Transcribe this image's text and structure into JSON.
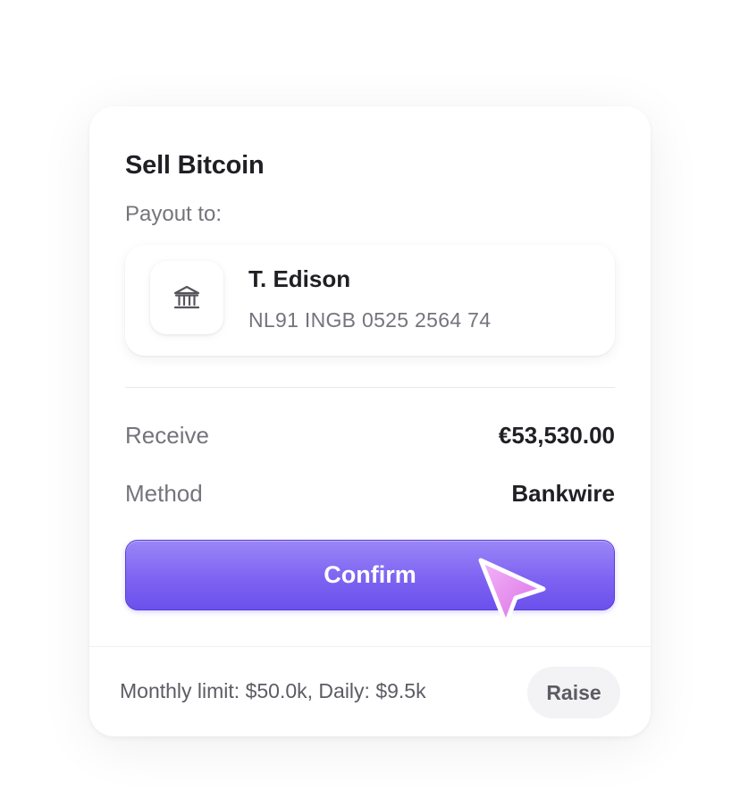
{
  "card": {
    "title": "Sell Bitcoin",
    "payout_label": "Payout to:"
  },
  "payee": {
    "icon": "bank-icon",
    "name": "T. Edison",
    "iban": "NL91 INGB 0525 2564 74"
  },
  "summary": {
    "receive_label": "Receive",
    "receive_value": "€53,530.00",
    "method_label": "Method",
    "method_value": "Bankwire"
  },
  "actions": {
    "confirm_label": "Confirm"
  },
  "footer": {
    "limit_text": "Monthly limit: $50.0k, Daily: $9.5k",
    "raise_label": "Raise"
  },
  "colors": {
    "accent": "#7e63f2",
    "cursor": "#e78cf2",
    "text_primary": "#1f1f24",
    "text_secondary": "#74747c"
  }
}
